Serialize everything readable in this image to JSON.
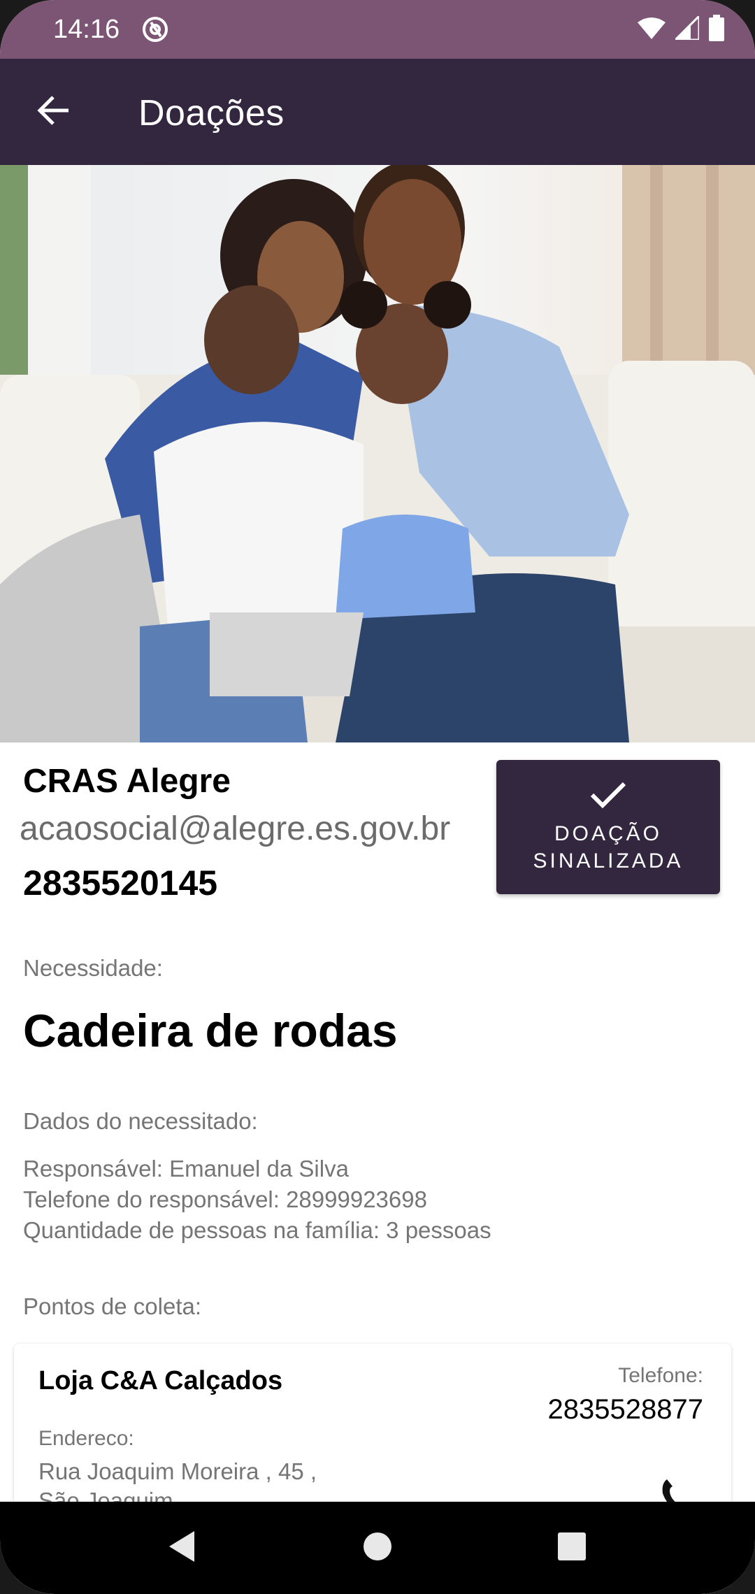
{
  "status_bar": {
    "time": "14:16",
    "background_color": "#7d5574",
    "icons": [
      "at-sign-icon",
      "wifi-icon",
      "cellular-signal-icon",
      "battery-icon"
    ]
  },
  "app_bar": {
    "title": "Doações",
    "back_icon": "arrow-back-icon",
    "background_color": "#33263f"
  },
  "hero_image": {
    "description_icon": "family-photo"
  },
  "organization": {
    "name": "CRAS Alegre",
    "email": "acaosocial@alegre.es.gov.br",
    "phone": "2835520145"
  },
  "signal_button": {
    "icon": "check-icon",
    "label": "DOAÇÃO\nSINALIZADA"
  },
  "need": {
    "label": "Necessidade:",
    "value": "Cadeira de rodas"
  },
  "beneficiary": {
    "label": "Dados do necessitado:",
    "lines": [
      "Responsável: Emanuel da Silva",
      "Telefone do responsável: 28999923698",
      "Quantidade de pessoas na família: 3 pessoas"
    ]
  },
  "collection_points": {
    "label": "Pontos de coleta:",
    "items": [
      {
        "name": "Loja C&A Calçados",
        "phone_label": "Telefone:",
        "phone": "2835528877",
        "address_label": "Endereco:",
        "address_lines": [
          "Rua Joaquim Moreira , 45 ,",
          "São Joaquim"
        ],
        "call_icon": "phone-icon"
      }
    ]
  },
  "nav_bar": {
    "icons": [
      "back-triangle-icon",
      "home-circle-icon",
      "recents-square-icon"
    ]
  }
}
